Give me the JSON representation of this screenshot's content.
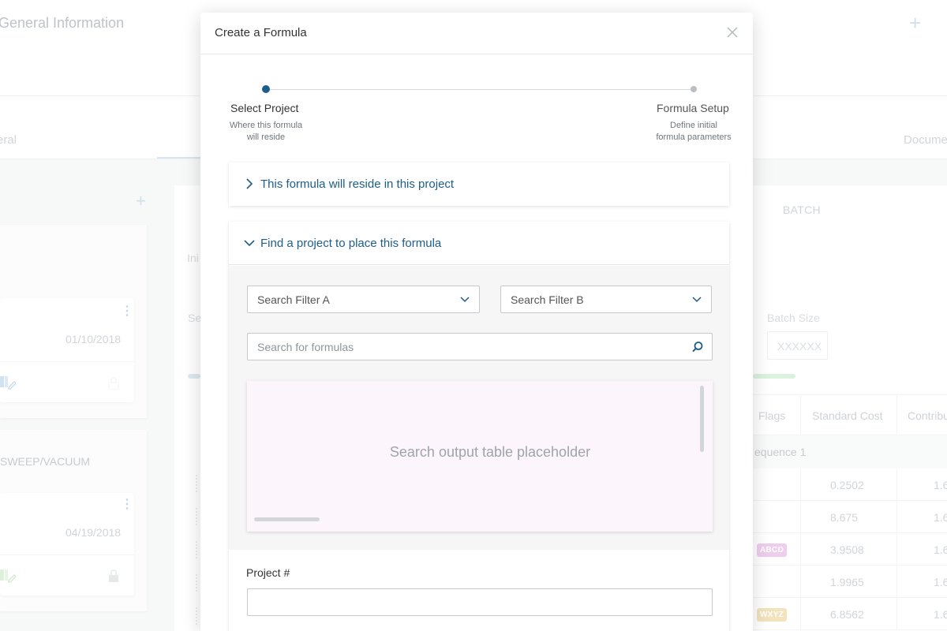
{
  "background": {
    "title": "General Information",
    "tab_left": "eral",
    "tab_right": "Docume",
    "initial_label": "Ini",
    "search_label": "Se",
    "batch_header": "BATCH",
    "batch_size_label": "Batch Size",
    "batch_size_value": "XXXXXX",
    "cards": [
      {
        "date": "01/10/2018"
      },
      {
        "title": "SWEEP/VACUUM",
        "date": "04/19/2018"
      }
    ],
    "table": {
      "headers": [
        "Flags",
        "Standard Cost",
        "Contribu"
      ],
      "sequence_label": "equence 1",
      "rows": [
        {
          "flag": "",
          "cost": "0.2502",
          "contrib": "1.6"
        },
        {
          "flag": "",
          "cost": "8.675",
          "contrib": "1.6"
        },
        {
          "flag": "ABCD",
          "cost": "3.9508",
          "contrib": "1.6"
        },
        {
          "flag": "",
          "cost": "1.9965",
          "contrib": "1.6"
        },
        {
          "flag": "WXYZ",
          "cost": "6.8562",
          "contrib": "1.6"
        }
      ]
    },
    "colors": {
      "badge_abcd": "#e6b3e4",
      "badge_wxyz": "#ecd49a",
      "accent": "#1d5d8a"
    }
  },
  "modal": {
    "title": "Create a Formula",
    "close_icon": "close-icon",
    "steps": [
      {
        "title": "Select Project",
        "desc_line1": "Where this formula",
        "desc_line2": "will reside"
      },
      {
        "title": "Formula Setup",
        "desc_line1": "Define initial",
        "desc_line2": "formula parameters"
      }
    ],
    "accordion_1": {
      "label": "This formula will reside in this project"
    },
    "accordion_2": {
      "label": "Find a project to place this formula",
      "filter_a": "Search Filter A",
      "filter_b": "Search Filter B",
      "search_placeholder": "Search for formulas",
      "results_placeholder": "Search output table placeholder",
      "project_label": "Project #",
      "project_value": ""
    }
  }
}
